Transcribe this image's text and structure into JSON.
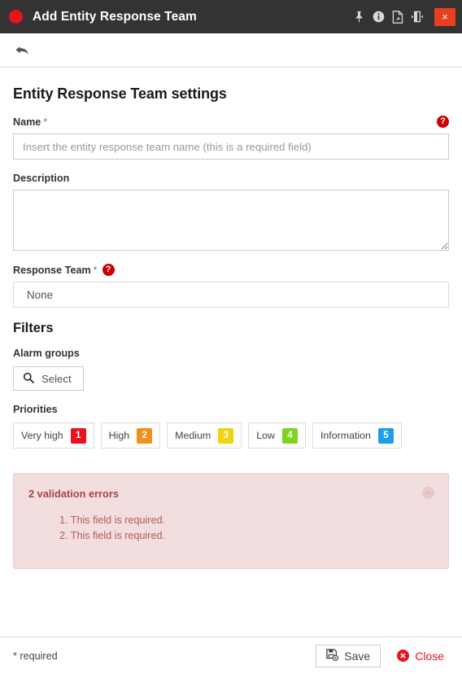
{
  "titlebar": {
    "title": "Add Entity Response Team",
    "status_dot": "red-circle-icon",
    "actions": [
      {
        "name": "pin-icon",
        "label": "Pin"
      },
      {
        "name": "info-icon",
        "label": "Info"
      },
      {
        "name": "pdf-export-icon",
        "label": "Export PDF"
      },
      {
        "name": "flip-panel-icon",
        "label": "Flip panel"
      }
    ],
    "close_label": "×"
  },
  "toolbar": {
    "back_label": "Back"
  },
  "form": {
    "section_title": "Entity Response Team settings",
    "name": {
      "label": "Name",
      "required_mark": "*",
      "placeholder": "Insert the entity response team name (this is a required field)",
      "value": "",
      "help": "?"
    },
    "description": {
      "label": "Description",
      "placeholder": "",
      "value": ""
    },
    "response_team": {
      "label": "Response Team",
      "required_mark": "*",
      "help": "?",
      "value": "None"
    }
  },
  "filters": {
    "title": "Filters",
    "alarm_groups": {
      "label": "Alarm groups",
      "select_label": "Select",
      "icon": "search-icon"
    },
    "priorities": {
      "label": "Priorities",
      "items": [
        {
          "label": "Very high",
          "badge": "1",
          "color": "#e8131b"
        },
        {
          "label": "High",
          "badge": "2",
          "color": "#f39019"
        },
        {
          "label": "Medium",
          "badge": "3",
          "color": "#f0d312"
        },
        {
          "label": "Low",
          "badge": "4",
          "color": "#7ed321"
        },
        {
          "label": "Information",
          "badge": "5",
          "color": "#1a9fe8"
        }
      ]
    }
  },
  "validation": {
    "title": "2 validation errors",
    "errors": [
      "1. This field is required.",
      "2. This field is required."
    ],
    "collapse_icon": "chevron-up-icon",
    "background_color": "#f2dede",
    "text_color": "#a94442"
  },
  "footer": {
    "required_note": "* required",
    "save_label": "Save",
    "close_label": "Close",
    "close_color": "#e8131b"
  }
}
